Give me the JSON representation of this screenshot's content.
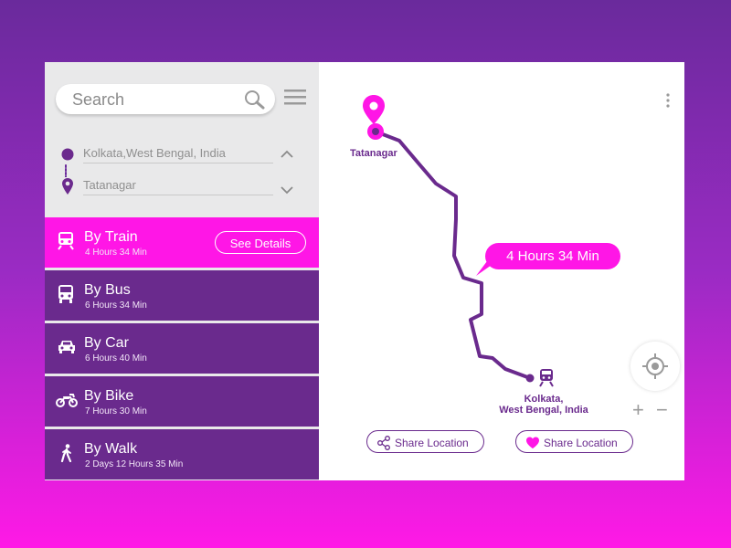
{
  "search": {
    "placeholder": "Search"
  },
  "locations": {
    "origin": "Kolkata,West Bengal, India",
    "destination": "Tatanagar"
  },
  "modes": [
    {
      "title": "By Train",
      "duration": "4 Hours 34 Min",
      "icon": "train-icon",
      "active": true,
      "action_label": "See Details"
    },
    {
      "title": "By Bus",
      "duration": "6 Hours 34 Min",
      "icon": "bus-icon"
    },
    {
      "title": "By Car",
      "duration": "6 Hours 40 Min",
      "icon": "car-icon"
    },
    {
      "title": "By Bike",
      "duration": "7 Hours 30 Min",
      "icon": "motorbike-icon"
    },
    {
      "title": "By Walk",
      "duration": "2 Days 12 Hours 35 Min",
      "icon": "walk-icon"
    }
  ],
  "map": {
    "start_label": "Tatanagar",
    "end_label_line1": "Kolkata,",
    "end_label_line2": "West Bengal, India",
    "duration_bubble": "4 Hours 34 Min",
    "share_buttons": [
      {
        "label": "Share Location",
        "icon": "share-icon"
      },
      {
        "label": "Share Location",
        "icon": "heart-icon"
      }
    ],
    "zoom_in": "+",
    "zoom_out": "−"
  },
  "colors": {
    "purple": "#6a2a8d",
    "magenta": "#ff16e6",
    "panel": "#e9e9ea"
  }
}
